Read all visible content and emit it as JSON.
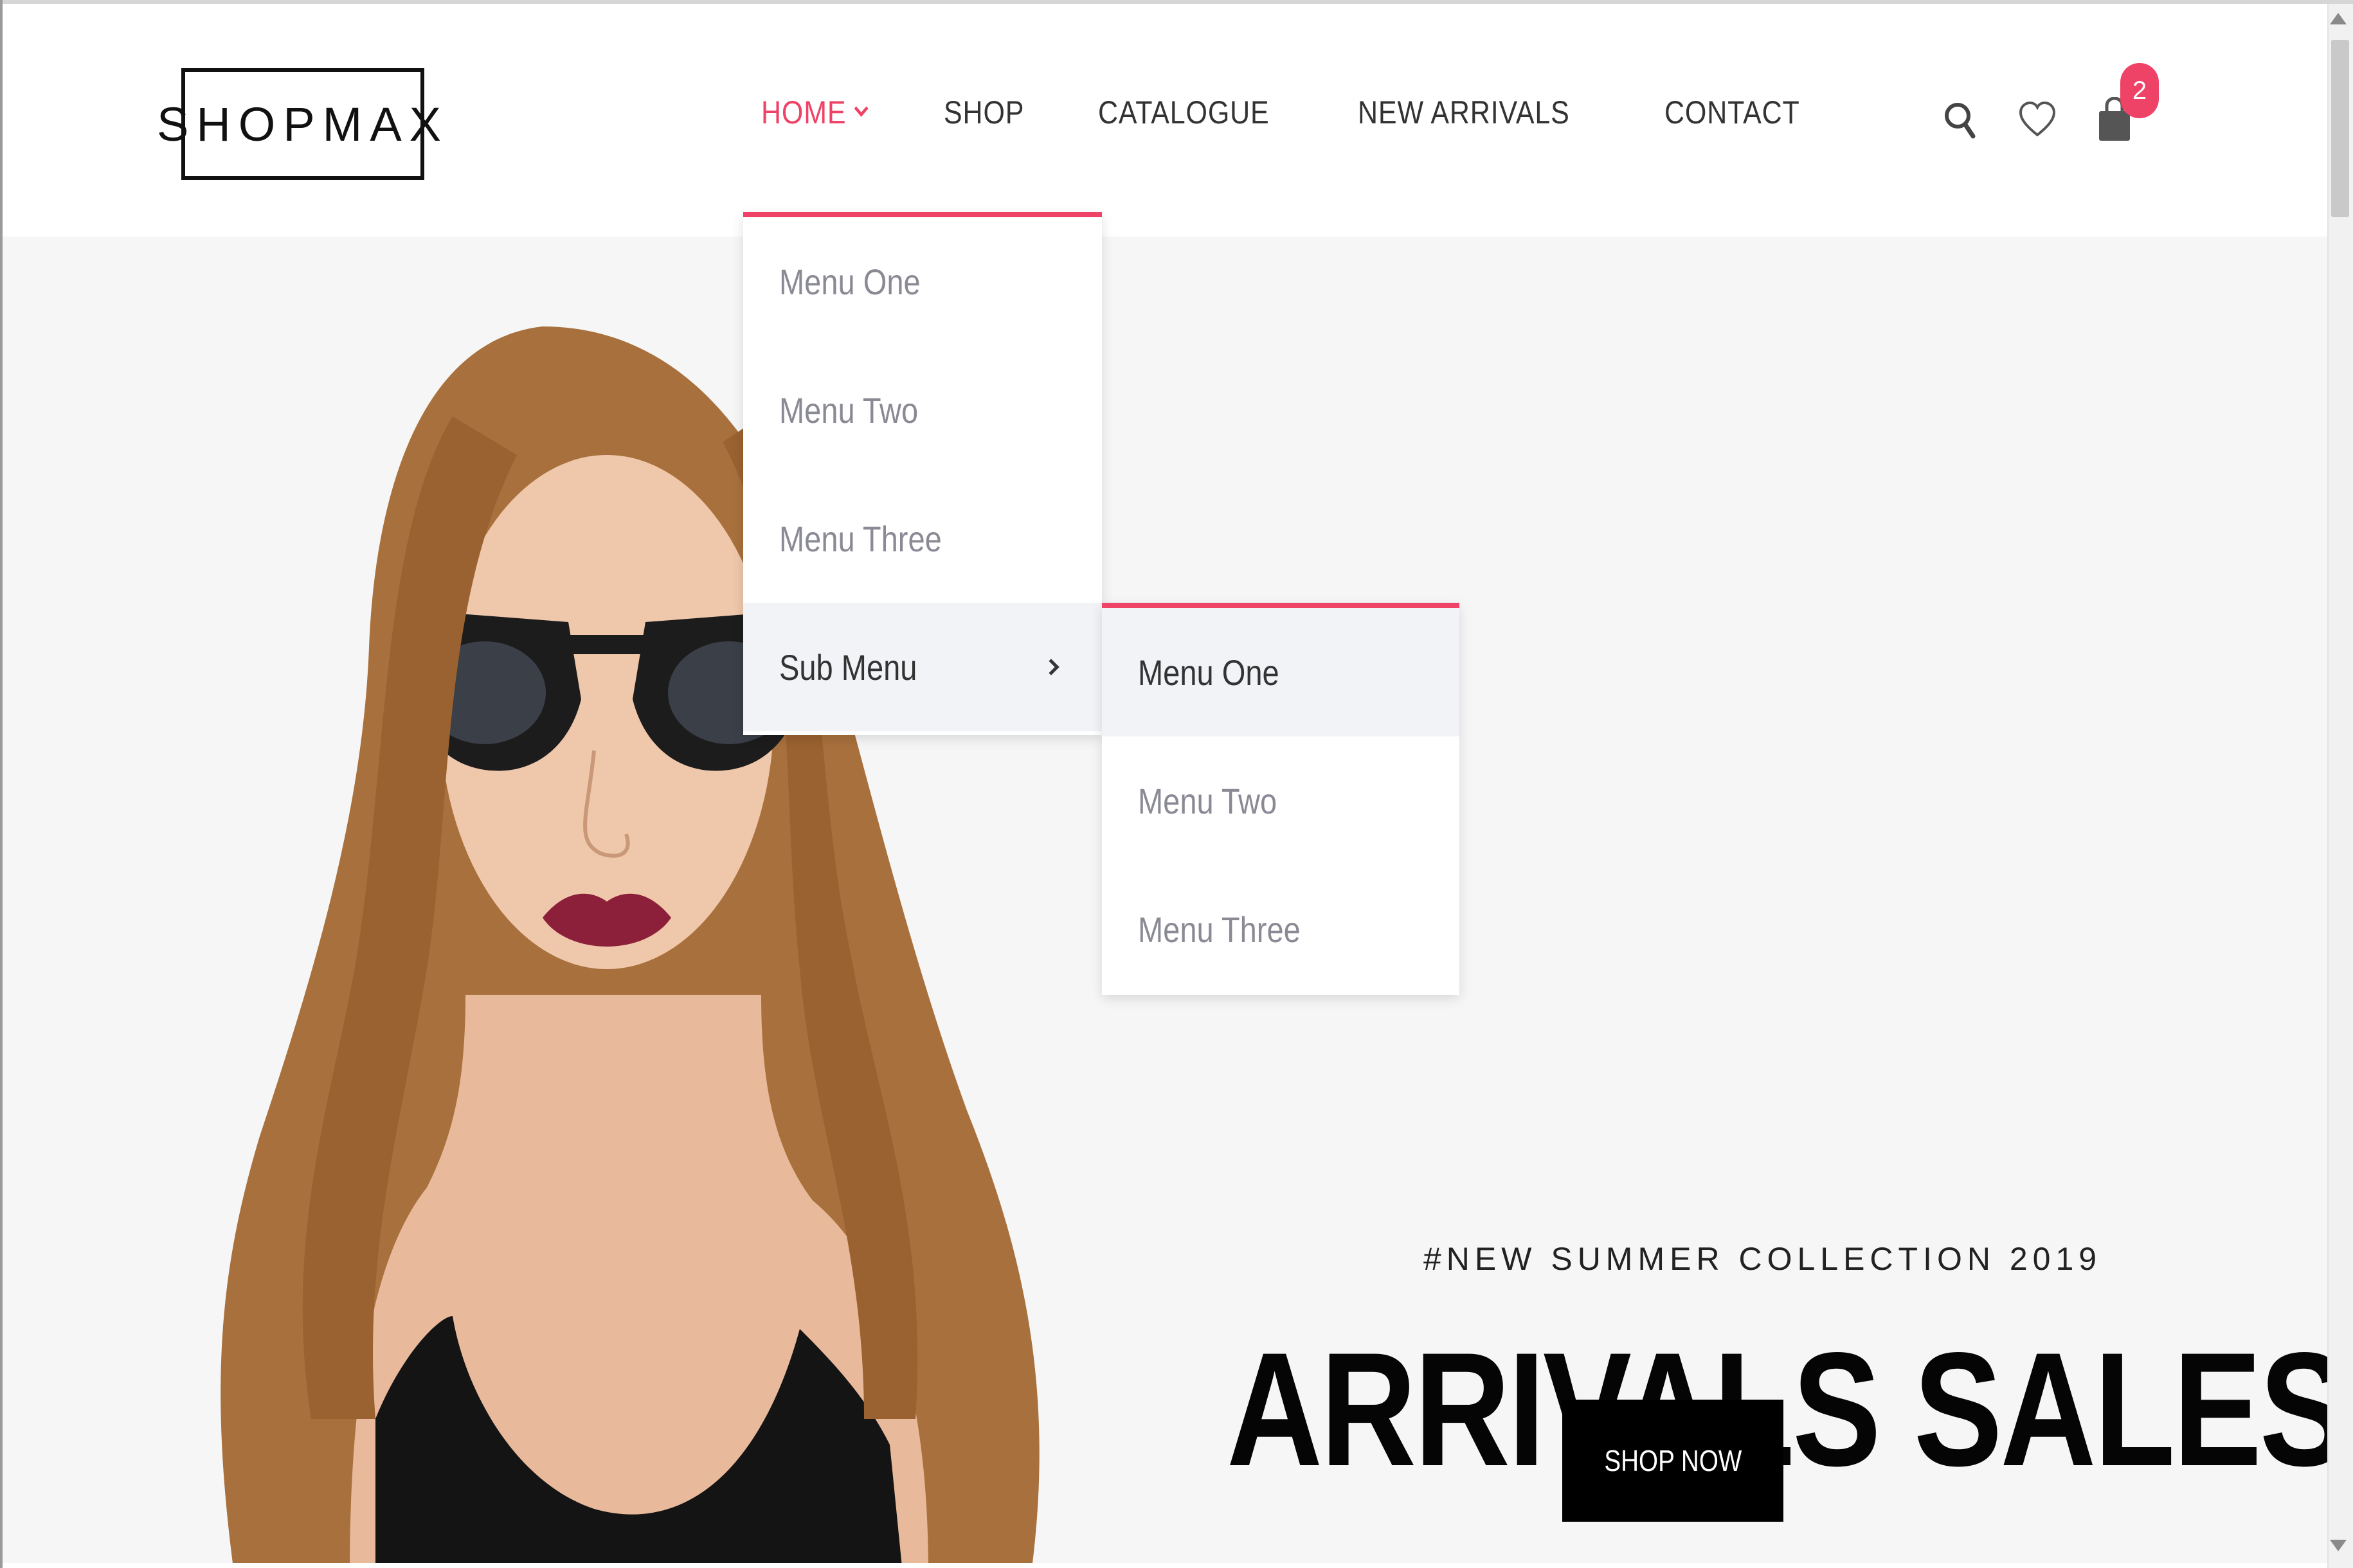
{
  "header": {
    "logo_text": "SHOPMAX",
    "nav": [
      {
        "label": "HOME",
        "active": true
      },
      {
        "label": "SHOP",
        "active": false
      },
      {
        "label": "CATALOGUE",
        "active": false
      },
      {
        "label": "NEW ARRIVALS",
        "active": false
      },
      {
        "label": "CONTACT",
        "active": false
      }
    ],
    "icons": [
      "search-icon",
      "heart-icon",
      "shopping-bag-icon"
    ],
    "cart_count": "2"
  },
  "dropdown": {
    "items": [
      "Menu One",
      "Menu Two",
      "Menu Three",
      "Sub Menu"
    ],
    "submenu_items": [
      "Menu One",
      "Menu Two",
      "Menu Three"
    ]
  },
  "hero": {
    "tagline": "#NEW SUMMER COLLECTION 2019",
    "headline": "ARRIVALS SALES",
    "cta_label": "SHOP NOW"
  },
  "colors": {
    "accent": "#ee4266",
    "hero_bg": "#f6f6f6",
    "button_bg": "#000000",
    "text_dark": "#333333",
    "menu_text": "#8a8a95"
  }
}
